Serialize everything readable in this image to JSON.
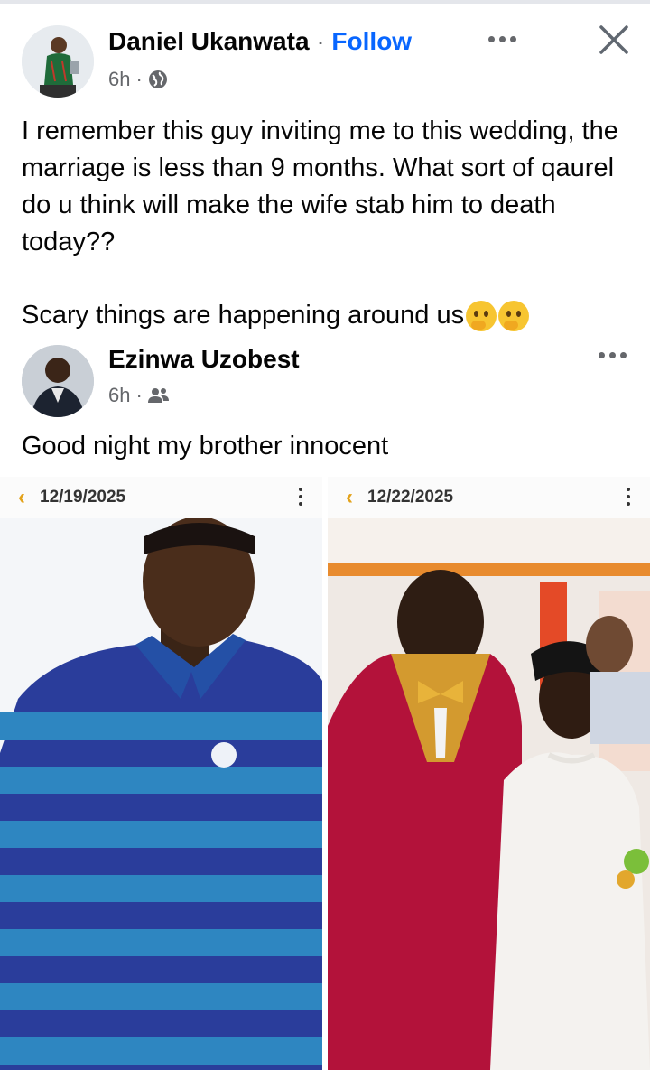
{
  "post": {
    "author": "Daniel Ukanwata",
    "separator": "·",
    "follow_label": "Follow",
    "time": "6h",
    "meta_separator": "·",
    "audience_icon": "globe-icon",
    "text_lines": "I remember this guy inviting me to this wedding, the marriage is less than 9 months. What sort of qaurel do u think will make the wife stab him to death today??",
    "text_last": "Scary things are happening around us"
  },
  "shared_post": {
    "author": "Ezinwa Uzobest",
    "time": "6h",
    "meta_separator": "·",
    "audience_icon": "friends-icon",
    "text": "Good night my brother innocent"
  },
  "photos": [
    {
      "date": "12/19/2025",
      "description": "man-in-striped-polo-photo"
    },
    {
      "date": "12/22/2025",
      "description": "wedding-couple-photo"
    }
  ],
  "colors": {
    "follow": "#0866ff",
    "secondary_text": "#65676b",
    "date_chevron": "#e3a21a"
  }
}
